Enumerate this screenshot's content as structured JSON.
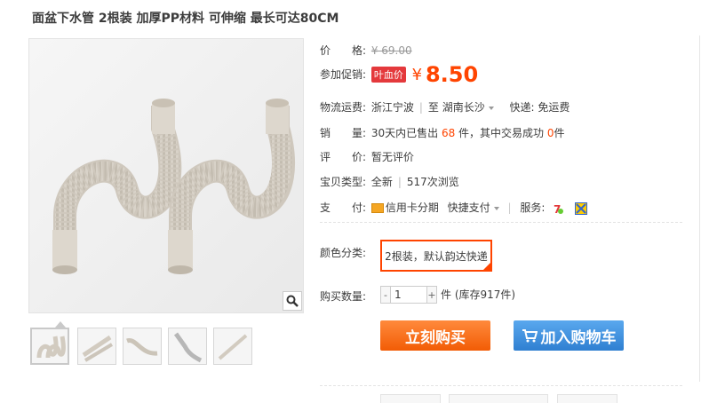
{
  "product": {
    "title": "面盆下水管 2根装 加厚PP材料 可伸缩 最长可达80CM"
  },
  "price": {
    "label": "价　　格:",
    "original": "¥ 69.00"
  },
  "promo": {
    "label": "参加促销:",
    "badge": "叶血价",
    "currency": "¥",
    "price": "8.50"
  },
  "logistics": {
    "label": "物流运费:",
    "from": "浙江宁波",
    "sep": "|",
    "to": "至  湖南长沙",
    "shipping": "快递: 免运费"
  },
  "sales": {
    "label": "销　　量:",
    "prefix": "30天内已售出",
    "sold": "68",
    "mid": "件，其中交易成功",
    "success": "0",
    "suffix": "件"
  },
  "review": {
    "label": "评　　价:",
    "value": "暂无评价"
  },
  "item_type": {
    "label": "宝贝类型:",
    "condition": "全新",
    "sep": "|",
    "views": "517次浏览"
  },
  "payment": {
    "label": "支　　付:",
    "credit": "信用卡分期",
    "quick": "快捷支付",
    "service_label": "服务:"
  },
  "color": {
    "label": "颜色分类:",
    "selected": "2根装，默认韵达快递"
  },
  "quantity": {
    "label": "购买数量:",
    "value": "1",
    "minus": "-",
    "plus": "+",
    "stock": "件 (库存917件)"
  },
  "actions": {
    "buy": "立刻购买",
    "cart": "加入购物车"
  },
  "colors": {
    "accent": "#ff4400",
    "buy": "#f25c05",
    "cart": "#2f7fd1"
  }
}
